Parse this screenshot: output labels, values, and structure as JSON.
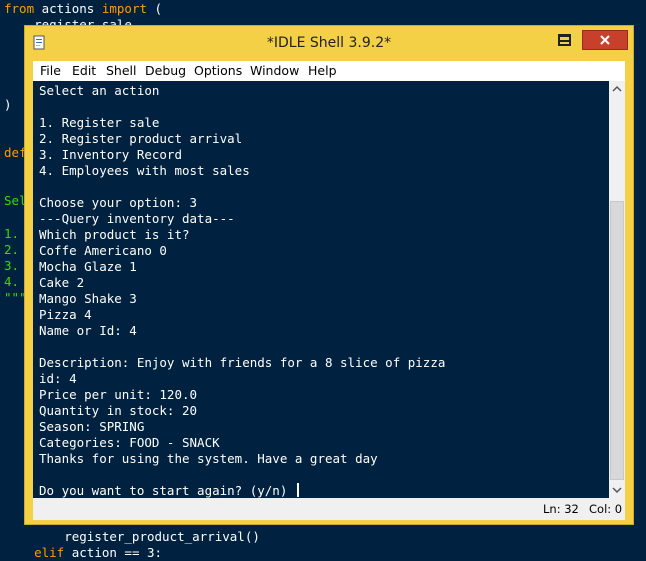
{
  "background_editor": {
    "line1_kw_from": "from",
    "line1_mid": " actions ",
    "line1_kw_import": "import",
    "line1_end": " (",
    "line2": "    register_sale,",
    "left1": ")",
    "left2": "def",
    "left3": "Sel",
    "left4": "1.",
    "left5": "2.",
    "left6": "3.",
    "left7": "4.",
    "left8": "\"\"\"",
    "bottom1": "        register_product_arrival()",
    "bottom2_kw": "elif",
    "bottom2_rest": " action == 3:"
  },
  "window": {
    "title": "*IDLE Shell 3.9.2*",
    "menu": [
      "File",
      "Edit",
      "Shell",
      "Debug",
      "Options",
      "Window",
      "Help"
    ],
    "shell_lines": [
      "Select an action",
      "",
      "1. Register sale",
      "2. Register product arrival",
      "3. Inventory Record",
      "4. Employees with most sales",
      "",
      "Choose your option: 3",
      "---Query inventory data---",
      "Which product is it?",
      "Coffe Americano 0",
      "Mocha Glaze 1",
      "Cake 2",
      "Mango Shake 3",
      "Pizza 4",
      "Name or Id: 4",
      "",
      "Description: Enjoy with friends for a 8 slice of pizza",
      "id: 4",
      "Price per unit: 120.0",
      "Quantity in stock: 20",
      "Season: SPRING",
      "Categories: FOOD - SNACK",
      "Thanks for using the system. Have a great day",
      "",
      "Do you want to start again? (y/n) "
    ],
    "status": {
      "ln": "Ln: 32",
      "col": "Col: 0"
    }
  },
  "colors": {
    "editor_bg": "#002240",
    "keyword": "#ff9d00",
    "window_frame": "#f4d046",
    "close_button": "#c7402c"
  },
  "icons": [
    "idle-app-icon",
    "minimize-icon",
    "maximize-icon",
    "close-icon",
    "scroll-up-icon",
    "scroll-down-icon"
  ]
}
